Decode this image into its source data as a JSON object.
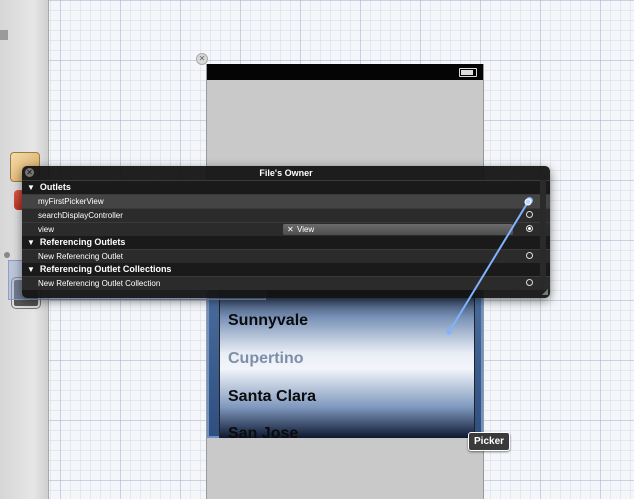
{
  "hud": {
    "title": "File's Owner",
    "sections": [
      {
        "label": "Outlets"
      },
      {
        "label": "Referencing Outlets"
      },
      {
        "label": "Referencing Outlet Collections"
      }
    ],
    "outlets": [
      {
        "label": "myFirstPickerView"
      },
      {
        "label": "searchDisplayController"
      },
      {
        "label": "view",
        "target": "View"
      }
    ],
    "referencing_outlets": [
      {
        "label": "New Referencing Outlet"
      }
    ],
    "referencing_collections": [
      {
        "label": "New Referencing Outlet Collection"
      }
    ]
  },
  "picker": {
    "rows": [
      "Sunnyvale",
      "Cupertino",
      "Santa Clara",
      "San Jose"
    ],
    "badge": "Picker"
  },
  "colors": {
    "selection": "#6d92c7",
    "wire": "#7fb2ff"
  }
}
